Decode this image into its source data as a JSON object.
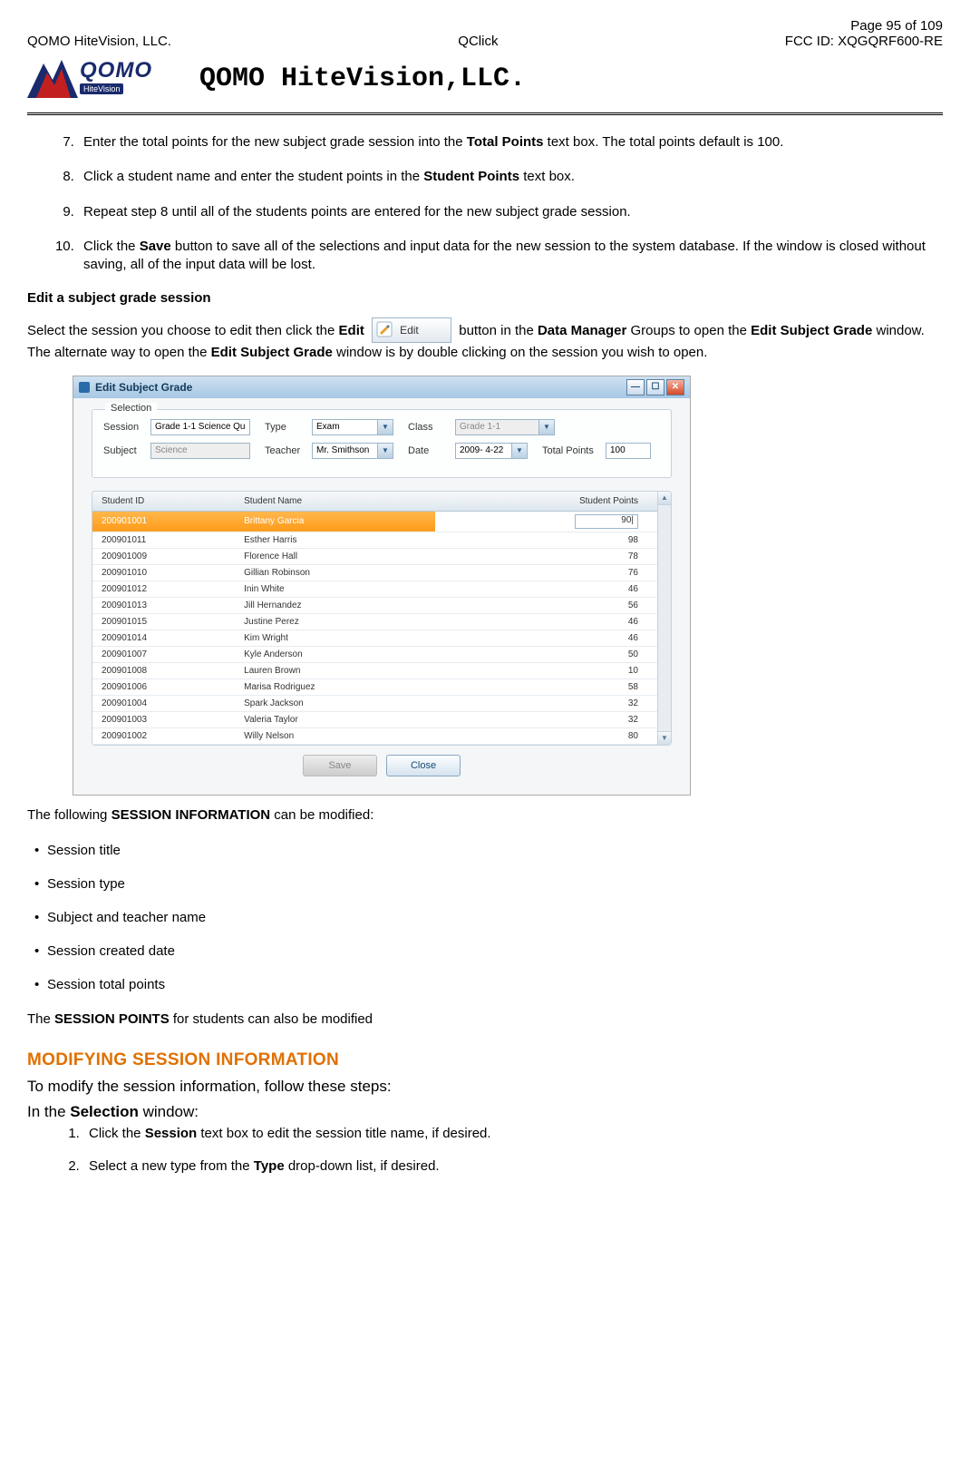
{
  "header": {
    "page_label": "Page 95 of 109",
    "left": "QOMO HiteVision, LLC.",
    "center": "QClick",
    "right": "FCC ID: XQGQRF600-RE",
    "company": "QOMO HiteVision,LLC.",
    "logo_main": "QOMO",
    "logo_sub": "HiteVision"
  },
  "steps": [
    {
      "n": "7.",
      "pre": "Enter the total points for the new subject grade session into the ",
      "b": "Total Points",
      "post": " text box. The total points default is 100."
    },
    {
      "n": "8.",
      "pre": "Click a student name and enter the student points in the ",
      "b": "Student Points",
      "post": " text box."
    },
    {
      "n": "9.",
      "pre": "Repeat step 8 until all of the students points are entered for the new subject grade session.",
      "b": "",
      "post": ""
    },
    {
      "n": "10.",
      "pre": "Click the ",
      "b": "Save",
      "post": " button to save all of the selections and input data for the new session to the system database. If the window is closed without saving, all of the input data will be lost."
    }
  ],
  "edit_section_title": "Edit a subject grade session",
  "edit_para": {
    "p1": "Select the session you choose to edit then click the ",
    "b1": "Edit",
    "p2": " button in the ",
    "b2": "Data Manager",
    "p3": " Groups to open the ",
    "b3": "Edit Subject Grade",
    "p4": " window. The alternate way to open the ",
    "b4": "Edit Subject Grade",
    "p5": " window is by double clicking on the session you wish to open."
  },
  "edit_btn_label": "Edit",
  "window": {
    "title": "Edit Subject Grade",
    "legend": "Selection",
    "fields": {
      "session_lbl": "Session",
      "session_val": "Grade 1-1 Science Qu",
      "type_lbl": "Type",
      "type_val": "Exam",
      "class_lbl": "Class",
      "class_val": "Grade 1-1",
      "subject_lbl": "Subject",
      "subject_val": "Science",
      "teacher_lbl": "Teacher",
      "teacher_val": "Mr. Smithson",
      "date_lbl": "Date",
      "date_val": "2009- 4-22",
      "total_lbl": "Total Points",
      "total_val": "100"
    },
    "cols": {
      "id": "Student ID",
      "name": "Student Name",
      "points": "Student Points"
    },
    "rows": [
      {
        "id": "200901001",
        "name": "Brittany Garcia",
        "points": "90|",
        "sel": true
      },
      {
        "id": "200901011",
        "name": "Esther Harris",
        "points": "98"
      },
      {
        "id": "200901009",
        "name": "Florence Hall",
        "points": "78"
      },
      {
        "id": "200901010",
        "name": "Gillian Robinson",
        "points": "76"
      },
      {
        "id": "200901012",
        "name": "Inin White",
        "points": "46"
      },
      {
        "id": "200901013",
        "name": "Jill Hernandez",
        "points": "56"
      },
      {
        "id": "200901015",
        "name": "Justine Perez",
        "points": "46"
      },
      {
        "id": "200901014",
        "name": "Kim Wright",
        "points": "46"
      },
      {
        "id": "200901007",
        "name": "Kyle Anderson",
        "points": "50"
      },
      {
        "id": "200901008",
        "name": "Lauren Brown",
        "points": "10"
      },
      {
        "id": "200901006",
        "name": "Marisa Rodriguez",
        "points": "58"
      },
      {
        "id": "200901004",
        "name": "Spark Jackson",
        "points": "32"
      },
      {
        "id": "200901003",
        "name": "Valeria Taylor",
        "points": "32"
      },
      {
        "id": "200901002",
        "name": "Willy Nelson",
        "points": "80"
      }
    ],
    "save_btn": "Save",
    "close_btn": "Close"
  },
  "following": {
    "pre": "The following ",
    "b": "SESSION INFORMATION",
    "post": " can be modified:"
  },
  "bullets": [
    "Session title",
    "Session type",
    "Subject and teacher name",
    "Session created date",
    "Session total points"
  ],
  "points_line": {
    "pre": "The ",
    "b": "SESSION POINTS",
    "post": " for students can also be modified"
  },
  "mod_heading": "MODIFYING SESSION INFORMATION",
  "mod_intro": "To modify the session information, follow these steps:",
  "mod_in": {
    "pre": "In the ",
    "b": "Selection",
    "post": " window:"
  },
  "mod_steps": [
    {
      "pre": "Click the ",
      "b": "Session",
      "post": " text box to edit the session title name, if desired."
    },
    {
      "pre": "Select a new type from the ",
      "b": "Type",
      "post": " drop-down list, if desired."
    }
  ]
}
